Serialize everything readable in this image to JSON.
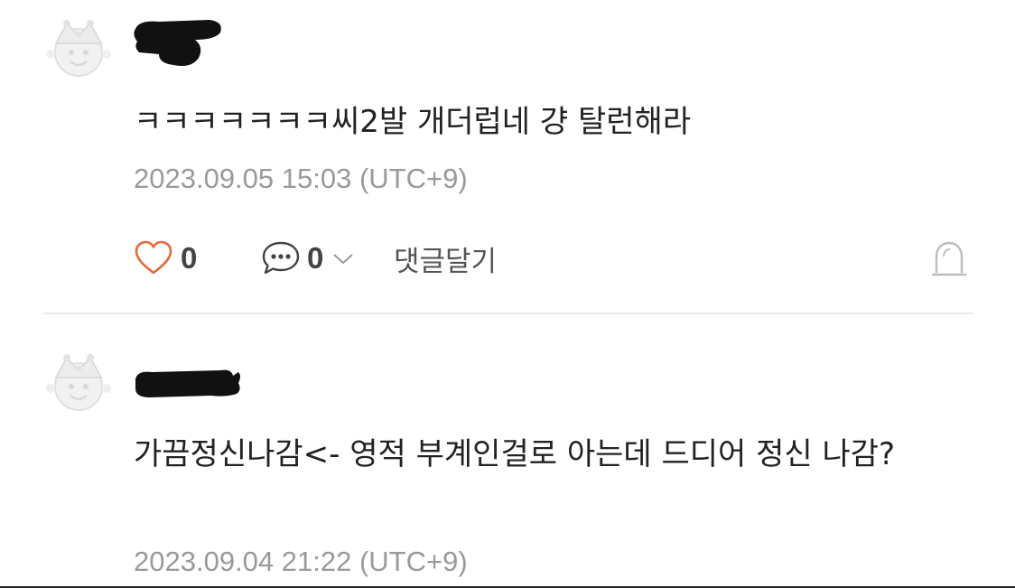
{
  "comments": [
    {
      "text": "ㅋㅋㅋㅋㅋㅋㅋ씨2발 개더럽네 걍 탈런해라",
      "timestamp": "2023.09.05 15:03 (UTC+9)",
      "likes": "0",
      "replies": "0",
      "reply_action": "댓글달기"
    },
    {
      "text": "가끔정신나감<- 영적 부계인걸로 아는데 드디어 정신 나감?",
      "timestamp": "2023.09.04 21:22 (UTC+9)"
    }
  ],
  "icons": {
    "like": "heart-icon",
    "reply": "speech-bubble-icon",
    "expand": "chevron-down-icon",
    "report": "siren-icon",
    "avatar": "jester-avatar-icon"
  },
  "colors": {
    "like_accent": "#e8683a",
    "meta_text": "#9a9a9a"
  }
}
